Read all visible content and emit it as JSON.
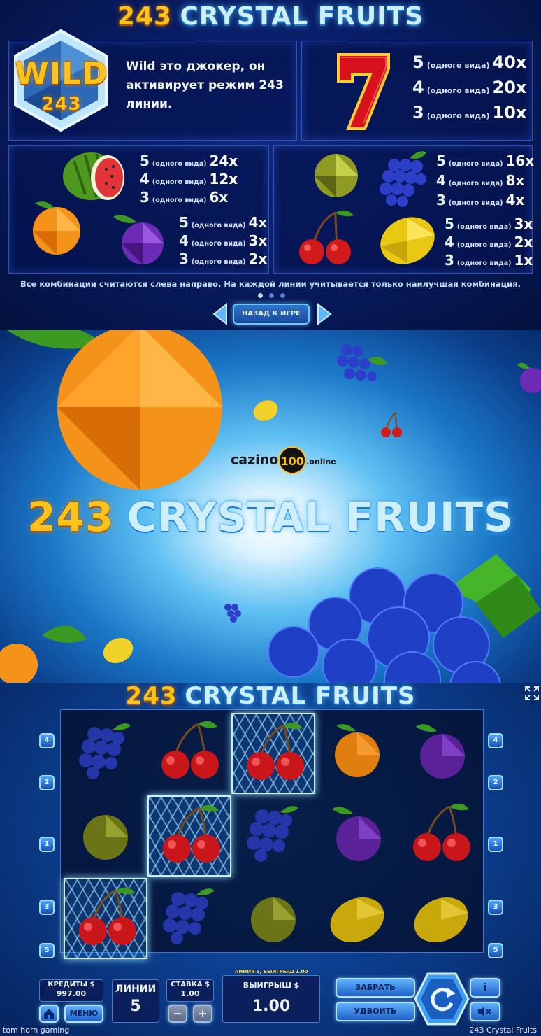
{
  "paytable": {
    "title_num": "243",
    "title_word": "CRYSTAL FRUITS",
    "wild": {
      "badge_word": "WILD",
      "badge_num": "243",
      "text": "Wild это джокер, он активирует режим 243 линии."
    },
    "same_kind": "(одного вида)",
    "seven": [
      {
        "n": "5",
        "x": "40x"
      },
      {
        "n": "4",
        "x": "20x"
      },
      {
        "n": "3",
        "x": "10x"
      }
    ],
    "watermelon": [
      {
        "n": "5",
        "x": "24x"
      },
      {
        "n": "4",
        "x": "12x"
      },
      {
        "n": "3",
        "x": "6x"
      }
    ],
    "orange_plum": [
      {
        "n": "5",
        "x": "4x"
      },
      {
        "n": "4",
        "x": "3x"
      },
      {
        "n": "3",
        "x": "2x"
      }
    ],
    "grapes": [
      {
        "n": "5",
        "x": "16x"
      },
      {
        "n": "4",
        "x": "8x"
      },
      {
        "n": "3",
        "x": "4x"
      }
    ],
    "lemon_cherry": [
      {
        "n": "5",
        "x": "3x"
      },
      {
        "n": "4",
        "x": "2x"
      },
      {
        "n": "3",
        "x": "1x"
      }
    ],
    "rule": "Все комбинации считаются слева направо. На каждой линии учитывается только наилучшая комбинация.",
    "back_button": "НАЗАД К ИГРЕ",
    "page_dots": 3,
    "active_dot": 0
  },
  "splash": {
    "title_num": "243",
    "title_word": "CRYSTAL FRUITS",
    "watermark_left": "cazino",
    "watermark_mid": "100",
    "watermark_right": ".online"
  },
  "game": {
    "title_num": "243",
    "title_word": "CRYSTAL FRUITS",
    "reels": [
      [
        "grapes",
        "cherry",
        "cherry",
        "orange",
        "plum"
      ],
      [
        "lime",
        "cherry",
        "grapes",
        "plum",
        "cherry"
      ],
      [
        "cherry",
        "grapes",
        "lime",
        "lemon",
        "lemon"
      ]
    ],
    "win_cells": [
      [
        0,
        2
      ],
      [
        1,
        1
      ],
      [
        2,
        0
      ]
    ],
    "left_lines": [
      "4",
      "2",
      "1",
      "3",
      "5"
    ],
    "right_lines": [
      "4",
      "2",
      "1",
      "3",
      "5"
    ],
    "credits_label": "КРЕДИТЫ $",
    "credits_value": "997.00",
    "lines_label": "ЛИНИИ",
    "lines_value": "5",
    "bet_label": "СТАВКА $",
    "bet_value": "1.00",
    "win_banner": "ЛИНИЯ 5, ВЫИГРЫШ 1.00",
    "win_label": "ВЫИГРЫШ $",
    "win_value": "1.00",
    "collect_button": "ЗАБРАТЬ",
    "double_button": "УДВОИТЬ",
    "menu_button": "МЕНЮ",
    "minus": "−",
    "plus": "+",
    "info_icon": "i",
    "home_icon": "home-icon",
    "sound_icon": "speaker-mute-icon"
  },
  "footer": {
    "left": "tom horn gaming",
    "right": "243 Crystal Fruits"
  },
  "colors": {
    "gold": "#ffc21a",
    "ice": "#cdefff",
    "deep_blue": "#05123a",
    "accent": "#4da8ff"
  }
}
